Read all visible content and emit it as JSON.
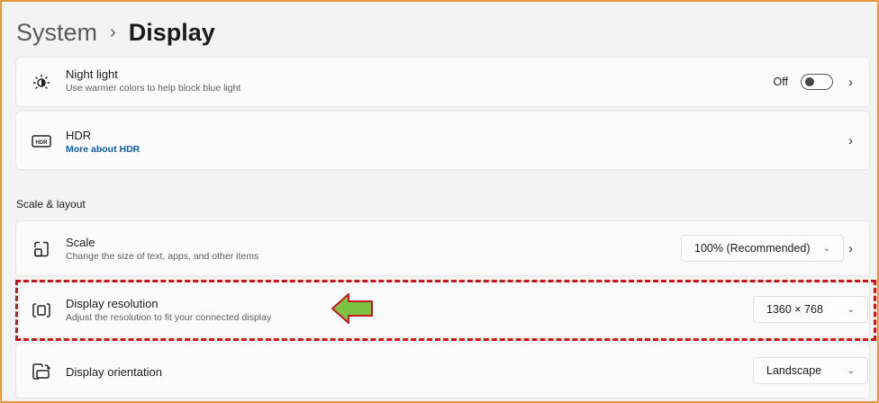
{
  "breadcrumb": {
    "parent": "System",
    "separator": "›",
    "current": "Display"
  },
  "night_light": {
    "title": "Night light",
    "description": "Use warmer colors to help block blue light",
    "toggle_label": "Off",
    "toggle_on": false,
    "icon": "night-light-icon"
  },
  "hdr": {
    "title": "HDR",
    "link": "More about HDR",
    "icon": "hdr-icon"
  },
  "section": {
    "title": "Scale & layout"
  },
  "scale": {
    "title": "Scale",
    "description": "Change the size of text, apps, and other items",
    "value": "100% (Recommended)",
    "icon": "scale-icon"
  },
  "resolution": {
    "title": "Display resolution",
    "description": "Adjust the resolution to fit your connected display",
    "value": "1360 × 768",
    "icon": "display-resolution-icon"
  },
  "orientation": {
    "title": "Display orientation",
    "value": "Landscape",
    "icon": "display-orientation-icon"
  },
  "glyphs": {
    "chevron_right": "›",
    "chevron_down": "⌄"
  },
  "colors": {
    "accent_link": "#0f5ca8",
    "highlight_border": "#c7171a",
    "arrow_fill": "#7cc242",
    "frame_border": "#e8973f"
  }
}
